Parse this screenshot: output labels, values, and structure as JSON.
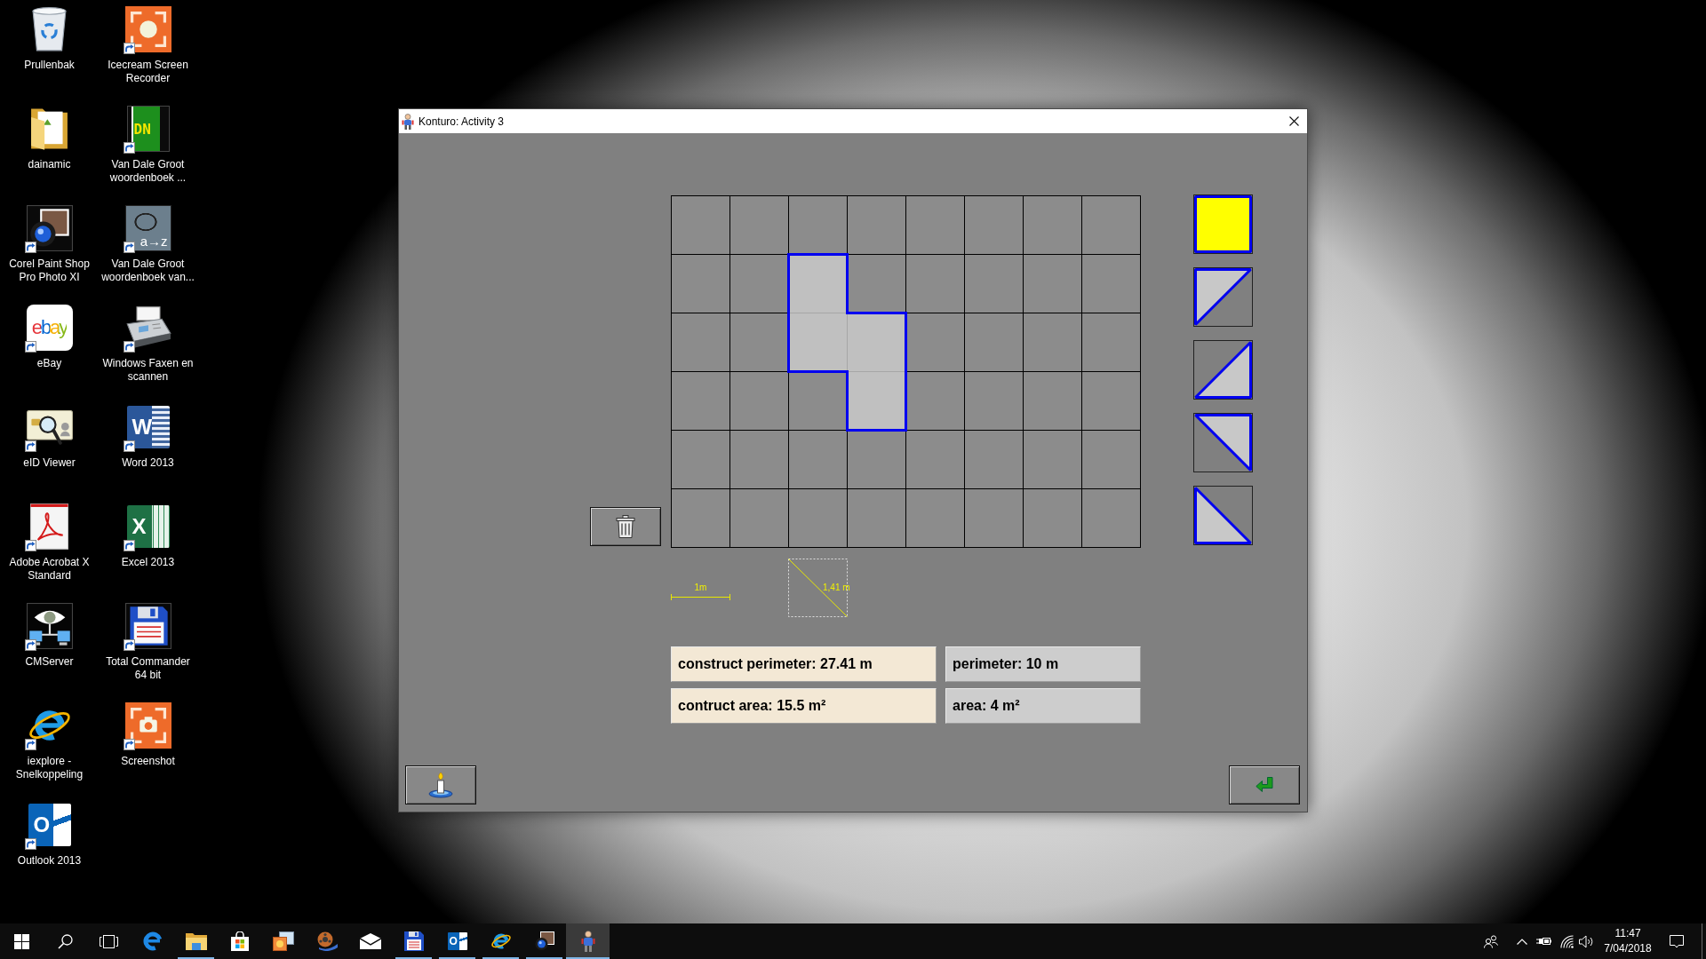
{
  "desktop_icons": [
    {
      "label": "Prullenbak",
      "kind": "bin",
      "shortcut": false
    },
    {
      "label": "dainamic",
      "kind": "folder",
      "shortcut": false
    },
    {
      "label": "Corel Paint Shop Pro Photo XI",
      "kind": "lens",
      "shortcut": true
    },
    {
      "label": "eBay",
      "kind": "wordmark",
      "logo_text": "ebay",
      "shortcut": true
    },
    {
      "label": "eID Viewer",
      "kind": "idcard",
      "shortcut": true
    },
    {
      "label": "Adobe Acrobat X Standard",
      "kind": "pdf",
      "shortcut": true
    },
    {
      "label": "CMServer",
      "kind": "eye",
      "shortcut": true
    },
    {
      "label": "iexplore - Snelkoppeling",
      "kind": "orbit",
      "shortcut": true
    },
    {
      "label": "Outlook 2013",
      "kind": "outlook",
      "logo_text": "O",
      "shortcut": true
    },
    {
      "label": "Icecream Screen Recorder",
      "kind": "recorder",
      "shortcut": true
    },
    {
      "label": "Van Dale Groot woordenboek ...",
      "kind": "book",
      "logo_text": "DN",
      "shortcut": true
    },
    {
      "label": "Van Dale Groot woordenboek van...",
      "kind": "dictionary",
      "logo_text": "a→z",
      "shortcut": true
    },
    {
      "label": "Windows Faxen en scannen",
      "kind": "fax",
      "shortcut": true
    },
    {
      "label": "Word 2013",
      "kind": "word",
      "logo_text": "W",
      "shortcut": true
    },
    {
      "label": "Excel 2013",
      "kind": "excel",
      "logo_text": "X",
      "shortcut": true
    },
    {
      "label": "Total Commander 64 bit",
      "kind": "floppy",
      "shortcut": true
    },
    {
      "label": "Screenshot",
      "kind": "snapshot",
      "shortcut": true
    }
  ],
  "window": {
    "title": "Konturo: Activity 3"
  },
  "grid": {
    "rows": [
      {
        "cells": [
          {
            "filled": false
          },
          {
            "filled": false
          },
          {
            "filled": false
          },
          {
            "filled": false
          },
          {
            "filled": false
          },
          {
            "filled": false
          },
          {
            "filled": false
          },
          {
            "filled": false
          }
        ]
      },
      {
        "cells": [
          {
            "filled": false
          },
          {
            "filled": false
          },
          {
            "filled": true
          },
          {
            "filled": false
          },
          {
            "filled": false
          },
          {
            "filled": false
          },
          {
            "filled": false
          },
          {
            "filled": false
          }
        ]
      },
      {
        "cells": [
          {
            "filled": false
          },
          {
            "filled": false
          },
          {
            "filled": true
          },
          {
            "filled": true
          },
          {
            "filled": false
          },
          {
            "filled": false
          },
          {
            "filled": false
          },
          {
            "filled": false
          }
        ]
      },
      {
        "cells": [
          {
            "filled": false
          },
          {
            "filled": false
          },
          {
            "filled": false
          },
          {
            "filled": true
          },
          {
            "filled": false
          },
          {
            "filled": false
          },
          {
            "filled": false
          },
          {
            "filled": false
          }
        ]
      },
      {
        "cells": [
          {
            "filled": false
          },
          {
            "filled": false
          },
          {
            "filled": false
          },
          {
            "filled": false
          },
          {
            "filled": false
          },
          {
            "filled": false
          },
          {
            "filled": false
          },
          {
            "filled": false
          }
        ]
      },
      {
        "cells": [
          {
            "filled": false
          },
          {
            "filled": false
          },
          {
            "filled": false
          },
          {
            "filled": false
          },
          {
            "filled": false
          },
          {
            "filled": false
          },
          {
            "filled": false
          },
          {
            "filled": false
          }
        ]
      }
    ]
  },
  "palette": [
    {
      "kind": "square",
      "selected": true
    },
    {
      "kind": "northwest",
      "selected": false
    },
    {
      "kind": "southeast",
      "selected": false
    },
    {
      "kind": "northeast",
      "selected": false
    },
    {
      "kind": "southwest",
      "selected": false
    }
  ],
  "scale": {
    "unit_label": "1m",
    "diagonal_label": "1,41 m"
  },
  "stats": [
    {
      "kind": "construct",
      "text": "construct perimeter: 27.41 m"
    },
    {
      "kind": "target",
      "text": "perimeter: 10 m"
    },
    {
      "kind": "construct",
      "text": "contruct area: 15.5 m²"
    },
    {
      "kind": "target",
      "text": "area: 4 m²"
    }
  ],
  "taskbar": {
    "apps": [
      {
        "kind": "edge",
        "running": false,
        "selected": false
      },
      {
        "kind": "explorer",
        "running": true,
        "selected": false
      },
      {
        "kind": "store",
        "running": false,
        "selected": false
      },
      {
        "kind": "photos",
        "running": false,
        "selected": false
      },
      {
        "kind": "movies",
        "running": false,
        "selected": false
      },
      {
        "kind": "mail",
        "running": false,
        "selected": false
      },
      {
        "kind": "floppy",
        "running": true,
        "selected": false
      },
      {
        "kind": "outlook",
        "logo_text": "O",
        "running": true,
        "selected": false
      },
      {
        "kind": "ie",
        "running": true,
        "selected": false
      },
      {
        "kind": "lens",
        "running": true,
        "selected": false
      },
      {
        "kind": "robot",
        "running": true,
        "selected": true
      }
    ],
    "clock": {
      "time": "11:47",
      "date": "7/04/2018"
    }
  }
}
